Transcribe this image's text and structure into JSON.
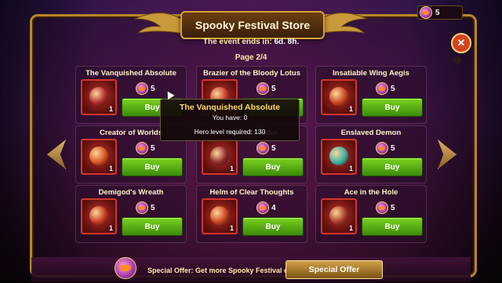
{
  "store": {
    "title": "Spooky Festival Store",
    "timer_label": "The event ends in: ",
    "timer_value": "6d. 8h.",
    "page": "Page 2/4",
    "coins_balance": "5",
    "close_symbol": "✕"
  },
  "items": [
    {
      "name": "The Vanquished Absolute",
      "price": "5",
      "qty": "1",
      "buy_label": "Buy",
      "color": "#b02a2a"
    },
    {
      "name": "Brazier of the Bloody Lotus",
      "price": "5",
      "qty": "1",
      "buy_label": "Buy",
      "color": "#c23a2a"
    },
    {
      "name": "Insatiable Wing Aegis",
      "price": "5",
      "qty": "1",
      "buy_label": "Buy",
      "color": "#c8461e"
    },
    {
      "name": "Creator of Worlds",
      "price": "5",
      "qty": "1",
      "buy_label": "Buy",
      "color": "#d4561e"
    },
    {
      "name": "Soul Shredder",
      "price": "5",
      "qty": "1",
      "buy_label": "Buy",
      "color": "#8a2a2a"
    },
    {
      "name": "Enslaved Demon",
      "price": "5",
      "qty": "1",
      "buy_label": "Buy",
      "color": "#3ab0a8"
    },
    {
      "name": "Demigod's Wreath",
      "price": "5",
      "qty": "1",
      "buy_label": "Buy",
      "color": "#c23a1e"
    },
    {
      "name": "Helm of Clear Thoughts",
      "price": "4",
      "qty": "1",
      "buy_label": "Buy",
      "color": "#c8461e"
    },
    {
      "name": "Ace in the Hole",
      "price": "5",
      "qty": "1",
      "buy_label": "Buy",
      "color": "#a83a2a"
    }
  ],
  "tooltip": {
    "title": "The Vanquished Absolute",
    "have_label": "You have: 0",
    "level_label": "Hero level required:  130"
  },
  "bottom": {
    "offer_text": "Special Offer: Get more Spooky Festival coins!",
    "offer_button": "Special Offer"
  },
  "icons": {
    "coin": "pumpkin-coin-icon",
    "close": "close-icon",
    "prev": "chevron-left-icon",
    "next": "chevron-right-icon"
  }
}
